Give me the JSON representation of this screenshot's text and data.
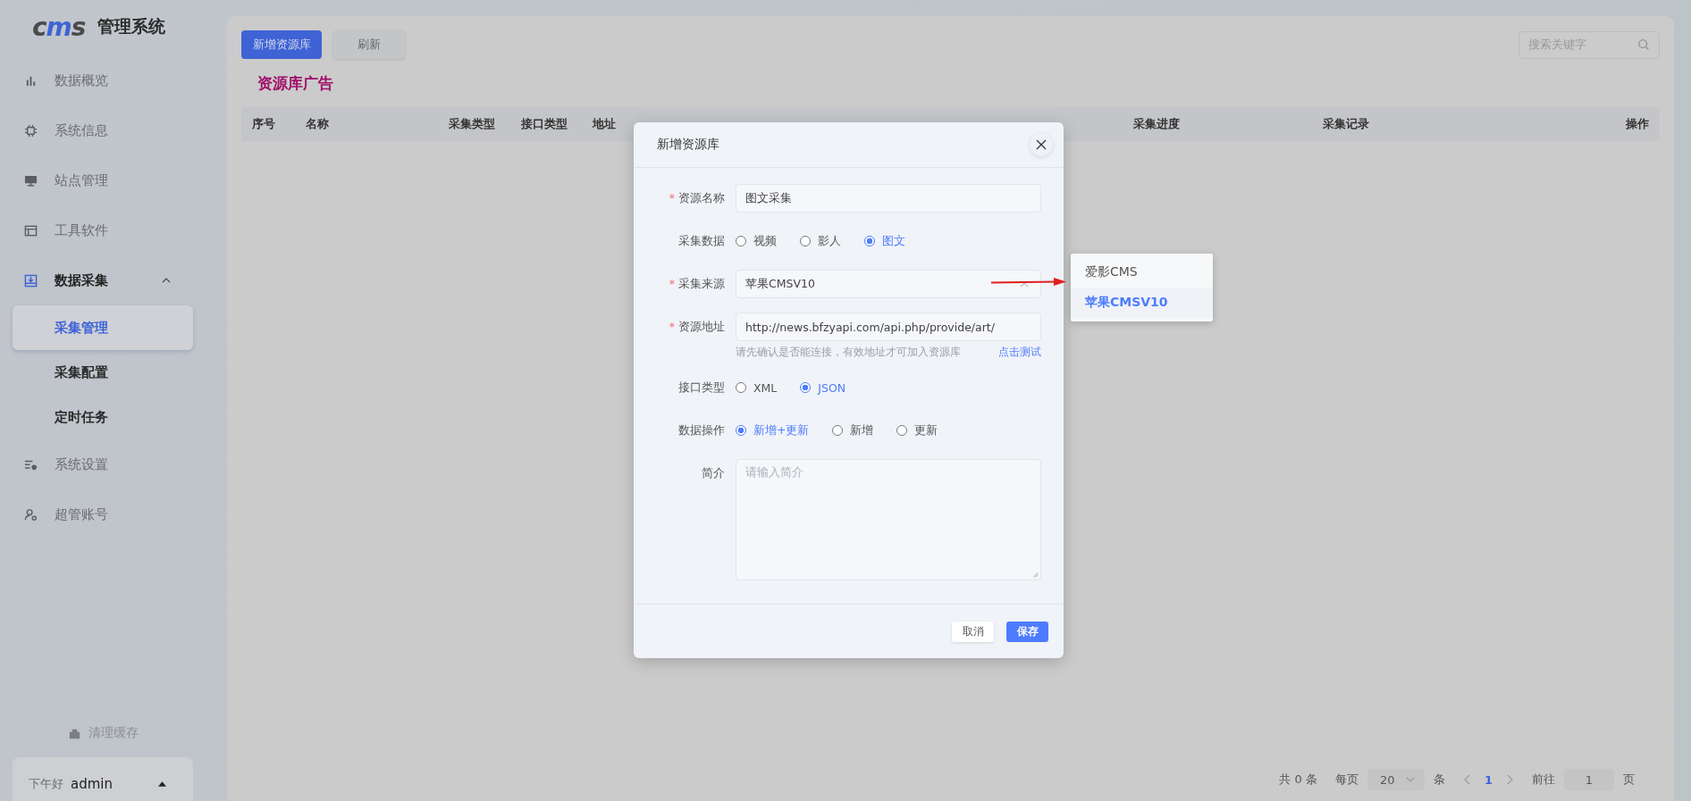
{
  "sidebar": {
    "logo": "cms",
    "title": "管理系统",
    "items": [
      {
        "label": "数据概览",
        "selected": false
      },
      {
        "label": "系统信息",
        "selected": false
      },
      {
        "label": "站点管理",
        "selected": false
      },
      {
        "label": "工具软件",
        "selected": false
      },
      {
        "label": "数据采集",
        "selected": false,
        "expanded": true,
        "children": [
          {
            "label": "采集管理",
            "selected": true
          },
          {
            "label": "采集配置",
            "selected": false
          },
          {
            "label": "定时任务",
            "selected": false
          }
        ]
      },
      {
        "label": "系统设置",
        "selected": false
      },
      {
        "label": "超管账号",
        "selected": false
      }
    ],
    "clear_cache": "清理缓存",
    "user": {
      "greeting": "下午好",
      "name": "admin"
    }
  },
  "main": {
    "buttons": [
      {
        "label": "新增资源库",
        "kind": "primary"
      },
      {
        "label": "刷新",
        "kind": "default"
      }
    ],
    "search": {
      "placeholder": "搜索关键字"
    },
    "title": "资源库广告",
    "table": {
      "columns": [
        "序号",
        "名称",
        "采集类型",
        "接口类型",
        "地址",
        "采集进度",
        "采集记录",
        "操作"
      ]
    },
    "pagination": {
      "total": "共 0 条",
      "per_page_label": "每页",
      "page_size": "20",
      "unit": "条",
      "current_page": "1",
      "goto_label": "前往",
      "goto_value": "1",
      "page_unit": "页"
    }
  },
  "modal": {
    "title": "新增资源库",
    "fields": [
      {
        "kind": "input",
        "label": "资源名称",
        "required_mark": "*",
        "value": "图文采集"
      },
      {
        "kind": "radio",
        "label": "采集数据",
        "options": [
          {
            "label": "视频",
            "selected": false
          },
          {
            "label": "影人",
            "selected": false
          },
          {
            "label": "图文",
            "selected": true
          }
        ]
      },
      {
        "kind": "select",
        "label": "采集来源",
        "required_mark": "*",
        "value": "苹果CMSV10",
        "open": true,
        "options": [
          {
            "label": "爱影CMS",
            "selected": false
          },
          {
            "label": "苹果CMSV10",
            "selected": true
          }
        ]
      },
      {
        "kind": "input",
        "label": "资源地址",
        "required_mark": "*",
        "value": "http://news.bfzyapi.com/api.php/provide/art/",
        "hint": "请先确认是否能连接，有效地址才可加入资源库",
        "link": "点击测试"
      },
      {
        "kind": "radio",
        "label": "接口类型",
        "options": [
          {
            "label": "XML",
            "selected": false
          },
          {
            "label": "JSON",
            "selected": true
          }
        ]
      },
      {
        "kind": "radio",
        "label": "数据操作",
        "options": [
          {
            "label": "新增+更新",
            "selected": true
          },
          {
            "label": "新增",
            "selected": false
          },
          {
            "label": "更新",
            "selected": false
          }
        ]
      },
      {
        "kind": "textarea",
        "label": "简介",
        "placeholder": "请输入简介"
      }
    ],
    "buttons": [
      {
        "label": "取消",
        "kind": "default"
      },
      {
        "label": "保存",
        "kind": "primary"
      }
    ]
  }
}
